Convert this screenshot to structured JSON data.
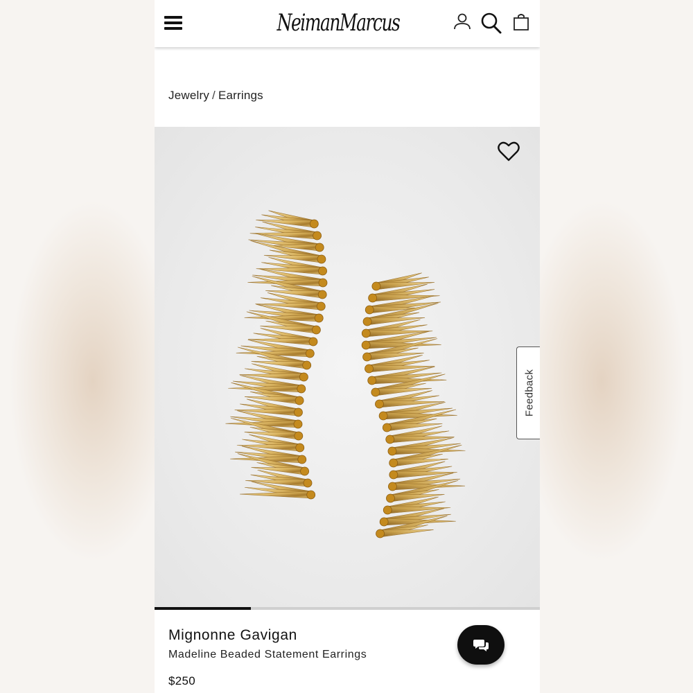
{
  "header": {
    "logo_text": "NeimanMarcus",
    "icons": [
      "menu-icon",
      "account-icon",
      "search-icon",
      "shopping-bag-icon"
    ]
  },
  "breadcrumb": {
    "items": [
      "Jewelry",
      "Earrings"
    ],
    "separator": "/"
  },
  "product": {
    "designer": "Mignonne Gavigan",
    "name": "Madeline Beaded Statement Earrings",
    "price": "$250",
    "image_carousel_progress": 0.25
  },
  "feedback": {
    "label": "Feedback"
  },
  "colors": {
    "gold": "#d9b25c",
    "bead": "#c48a1e",
    "image_bg": "#ebebeb",
    "text": "#111111"
  }
}
